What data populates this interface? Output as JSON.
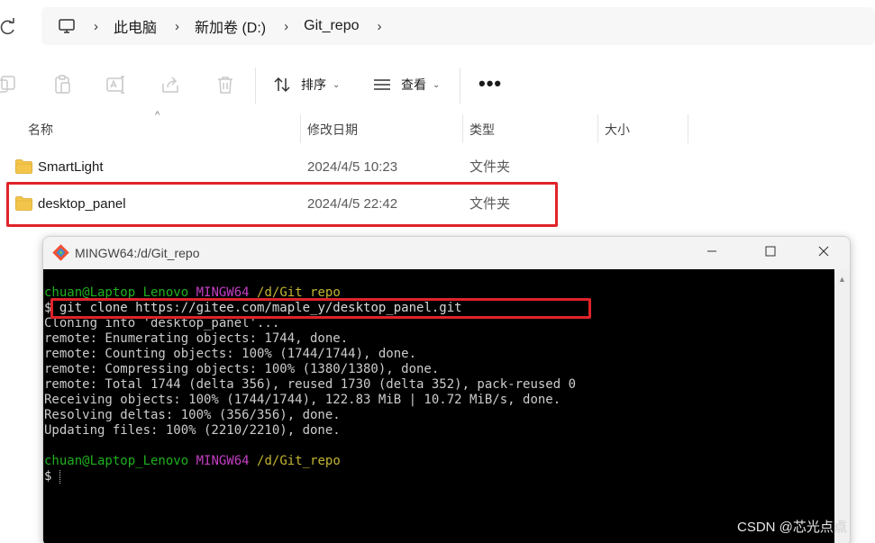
{
  "address": {
    "crumbs": [
      "此电脑",
      "新加卷 (D:)",
      "Git_repo"
    ]
  },
  "toolbar": {
    "sort_label": "排序",
    "view_label": "查看",
    "more_label": "•••"
  },
  "columns": {
    "name": "名称",
    "modified": "修改日期",
    "type": "类型",
    "size": "大小"
  },
  "files": [
    {
      "name": "SmartLight",
      "modified": "2024/4/5 10:23",
      "type": "文件夹"
    },
    {
      "name": "desktop_panel",
      "modified": "2024/4/5 22:42",
      "type": "文件夹"
    }
  ],
  "terminal": {
    "title": "MINGW64:/d/Git_repo",
    "prompt_user": "chuan@Laptop_Lenovo",
    "prompt_env": "MINGW64",
    "prompt_path": "/d/Git_repo",
    "prompt_symbol": "$",
    "command": "git clone https://gitee.com/maple_y/desktop_panel.git",
    "output": [
      "Cloning into 'desktop_panel'...",
      "remote: Enumerating objects: 1744, done.",
      "remote: Counting objects: 100% (1744/1744), done.",
      "remote: Compressing objects: 100% (1380/1380), done.",
      "remote: Total 1744 (delta 356), reused 1730 (delta 352), pack-reused 0",
      "Receiving objects: 100% (1744/1744), 122.83 MiB | 10.72 MiB/s, done.",
      "Resolving deltas: 100% (356/356), done.",
      "Updating files: 100% (2210/2210), done."
    ]
  },
  "watermark": "CSDN @芯光点点",
  "colors": {
    "highlight": "#e0232a",
    "prompt_green": "#1fb01f",
    "prompt_magenta": "#c53fc5",
    "prompt_yellow": "#c2b532",
    "folder": "#f3c54a"
  }
}
